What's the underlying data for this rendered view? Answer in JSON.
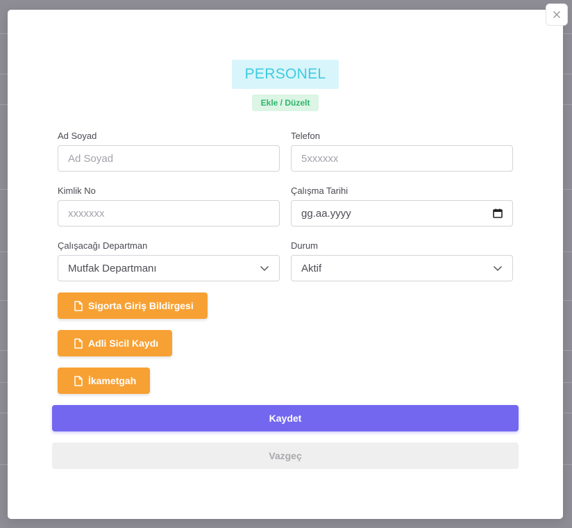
{
  "close_icon_name": "close-icon",
  "modal": {
    "title": "PERSONEL",
    "subtitle": "Ekle / Düzelt"
  },
  "form": {
    "name": {
      "label": "Ad Soyad",
      "placeholder": "Ad Soyad"
    },
    "phone": {
      "label": "Telefon",
      "placeholder": "5xxxxxx"
    },
    "id_no": {
      "label": "Kimlik No",
      "placeholder": "xxxxxxx"
    },
    "start_date": {
      "label": "Çalışma Tarihi",
      "value": "gg.aa.yyyy"
    },
    "department": {
      "label": "Çalışacağı Departman",
      "value": "Mutfak Departmanı"
    },
    "status": {
      "label": "Durum",
      "value": "Aktif"
    }
  },
  "documents": [
    {
      "label": "Sigorta Giriş Bildirgesi",
      "icon": "file-icon"
    },
    {
      "label": "Adli Sicil Kaydı",
      "icon": "file-icon"
    },
    {
      "label": "İkametgah",
      "icon": "file-icon"
    }
  ],
  "actions": {
    "save_label": "Kaydet",
    "cancel_label": "Vazgeç"
  },
  "colors": {
    "primary": "#7367f0",
    "orange": "#f7a134",
    "title_text": "#3ecbe0",
    "title_bg": "#d8f5fb",
    "badge_text": "#2db66a",
    "badge_bg": "#dcf5e5",
    "overlay": "#8e8c94"
  }
}
